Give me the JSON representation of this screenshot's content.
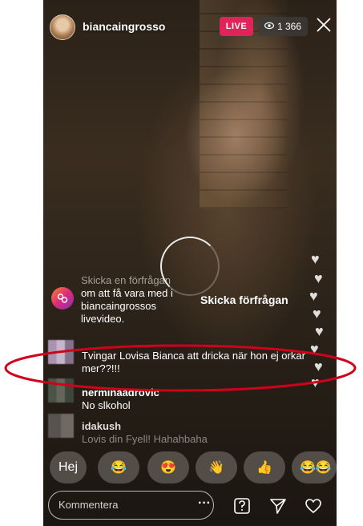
{
  "header": {
    "username": "biancaingrosso",
    "live_label": "LIVE",
    "viewer_count": "1 366"
  },
  "request": {
    "line1": "Skicka en förfrågan",
    "line2": "om att få vara med i",
    "line3": "biancaingrossos",
    "line4": "livevideo.",
    "button": "Skicka förfrågan"
  },
  "comments": [
    {
      "name": "",
      "text": "Tvingar Lovisa Bianca att dricka när hon ej orkar mer??!!!"
    },
    {
      "name": "nerminaadrovic",
      "text": "No slkohol"
    },
    {
      "name": "idakush",
      "text": "Lovis din Fyell! Hahahbaha"
    }
  ],
  "reactions": {
    "hej": "Hej",
    "laugh": "😂",
    "heart_eyes": "😍",
    "wave": "👋",
    "thumbs": "👍",
    "laugh2": "😂😂"
  },
  "comment_box": {
    "placeholder": "Kommentera",
    "more": "···"
  },
  "colors": {
    "live": "#e0245a",
    "highlight": "#d0021b"
  }
}
